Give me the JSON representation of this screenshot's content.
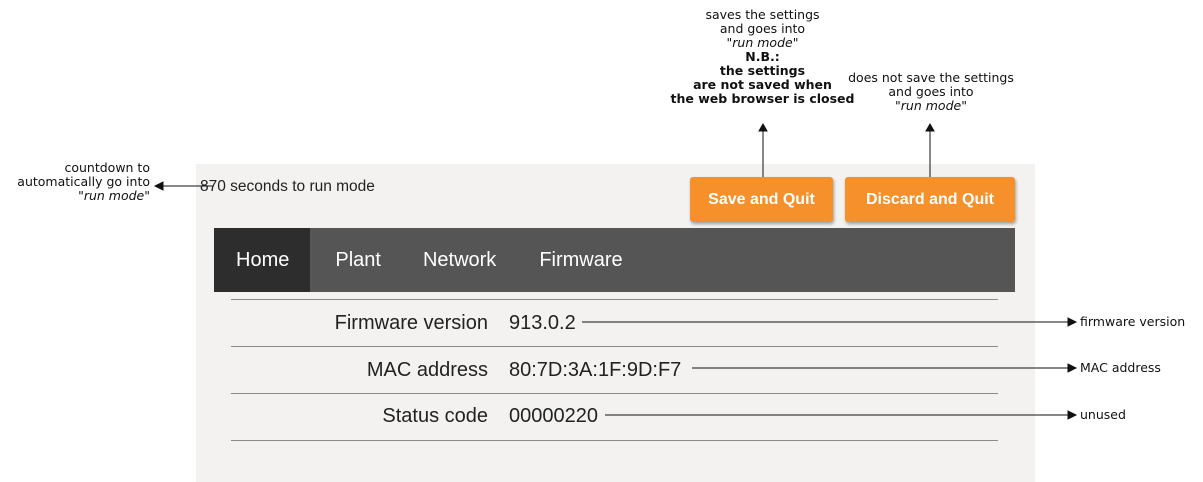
{
  "annotations": {
    "save": {
      "l1": "saves the settings",
      "l2": "and goes into",
      "l3_quote_open": "\"",
      "l3_italic": "run mode",
      "l3_quote_close": "\"",
      "l4": "N.B.:",
      "l5": "the settings",
      "l6": "are not saved when",
      "l7": "the web browser is closed"
    },
    "discard": {
      "l1": "does not save the settings",
      "l2": "and goes into",
      "l3_quote_open": "\"",
      "l3_italic": "run mode",
      "l3_quote_close": "\""
    },
    "countdown": {
      "l1": "countdown to",
      "l2": "automatically go into",
      "l3_quote_open": "\"",
      "l3_italic": "run mode",
      "l3_quote_close": "\""
    },
    "firmware": "firmware version",
    "mac": "MAC address",
    "status": "unused"
  },
  "header": {
    "countdown_text": "870 seconds to run mode",
    "save_label": "Save and Quit",
    "discard_label": "Discard and Quit"
  },
  "nav": {
    "items": [
      {
        "label": "Home",
        "active": true
      },
      {
        "label": "Plant"
      },
      {
        "label": "Network"
      },
      {
        "label": "Firmware"
      }
    ]
  },
  "info": {
    "rows": [
      {
        "label": "Firmware version",
        "value": "913.0.2"
      },
      {
        "label": "MAC address",
        "value": "80:7D:3A:1F:9D:F7"
      },
      {
        "label": "Status code",
        "value": "00000220"
      }
    ]
  },
  "colors": {
    "accent": "#f5902a",
    "navbar": "#565556",
    "nav_active": "#2d2d2d",
    "panel": "#f3f2f1"
  }
}
